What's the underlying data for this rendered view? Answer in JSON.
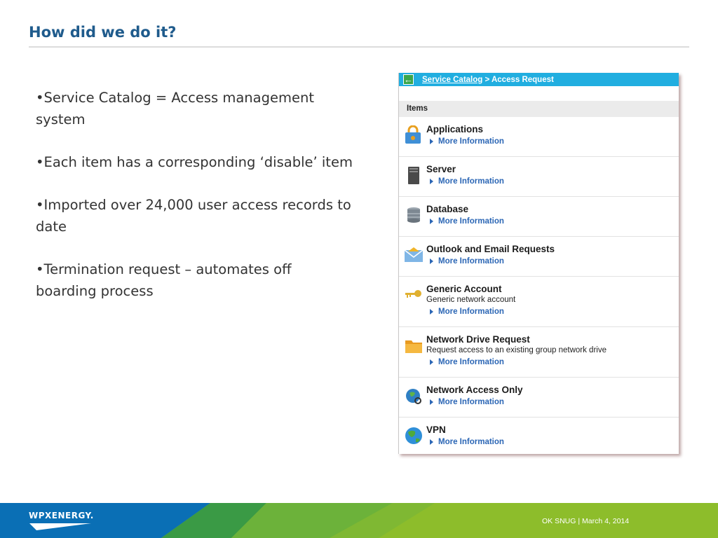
{
  "slide": {
    "title": "How did we do it?",
    "bullets": [
      "•Service Catalog  =  Access management system",
      "•Each item has a corresponding ‘disable’ item",
      "•Imported over 24,000 user access records to date",
      "•Termination request – automates off boarding process"
    ]
  },
  "catalog": {
    "breadcrumb_link": "Service Catalog",
    "breadcrumb_current": " > Access Request",
    "items_header": "Items",
    "more_label": "More Information",
    "items": [
      {
        "name": "Applications",
        "desc": "",
        "icon": "lock-icon"
      },
      {
        "name": "Server",
        "desc": "",
        "icon": "server-icon"
      },
      {
        "name": "Database",
        "desc": "",
        "icon": "database-icon"
      },
      {
        "name": "Outlook and Email Requests",
        "desc": "",
        "icon": "envelope-icon"
      },
      {
        "name": "Generic Account",
        "desc": "Generic network account",
        "icon": "key-icon"
      },
      {
        "name": "Network Drive Request",
        "desc": "Request access to an existing group network drive",
        "icon": "folder-icon"
      },
      {
        "name": "Network Access Only",
        "desc": "",
        "icon": "globe-search-icon"
      },
      {
        "name": "VPN",
        "desc": "",
        "icon": "globe-icon"
      }
    ]
  },
  "footer": {
    "logo": "WPXENERGY.",
    "text": "OK SNUG  |  March 4, 2014"
  },
  "colors": {
    "title": "#1f5b8c",
    "breadcrumb_bar": "#21aee0",
    "link": "#2b66b5",
    "footer_blue": "#0a6fb5",
    "footer_green": "#8dbd2b"
  }
}
